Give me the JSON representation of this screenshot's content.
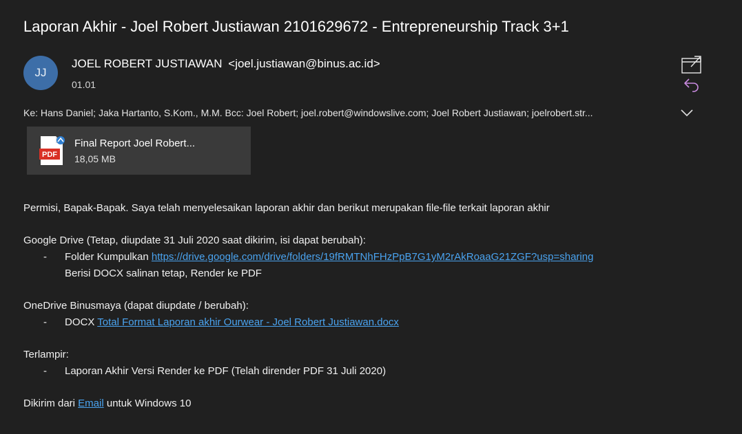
{
  "email": {
    "subject": "Laporan Akhir - Joel Robert Justiawan 2101629672 - Entrepreneurship Track 3+1",
    "avatar_initials": "JJ",
    "sender_name": "JOEL ROBERT JUSTIAWAN",
    "sender_email": "<joel.justiawan@binus.ac.id>",
    "time": "01.01",
    "recipients": "Ke: Hans Daniel; Jaka Hartanto, S.Kom., M.M. Bcc: Joel Robert; joel.robert@windowslive.com; Joel Robert Justiawan; joelrobert.str...",
    "attachment": {
      "name": "Final Report Joel Robert...",
      "size": "18,05 MB",
      "badge": "PDF"
    }
  },
  "body": {
    "intro": "Permisi, Bapak-Bapak. Saya telah menyelesaikan laporan akhir dan berikut merupakan file-file terkait laporan akhir",
    "gdrive_heading": "Google Drive (Tetap, diupdate 31 Juli 2020 saat dikirim, isi dapat berubah):",
    "gdrive_item_prefix": "Folder Kumpulkan ",
    "gdrive_link": "https://drive.google.com/drive/folders/19fRMTNhFHzPpB7G1yM2rAkRoaaG21ZGF?usp=sharing",
    "gdrive_note": "Berisi DOCX salinan tetap, Render ke PDF",
    "onedrive_heading": "OneDrive Binusmaya (dapat diupdate / berubah):",
    "onedrive_item_prefix": "DOCX ",
    "onedrive_link": "Total Format Laporan akhir Ourwear - Joel Robert Justiawan.docx",
    "attached_heading": "Terlampir:",
    "attached_item": "Laporan Akhir Versi Render ke PDF (Telah dirender PDF 31 Juli 2020)",
    "footer_prefix": "Dikirim dari ",
    "footer_link": "Email",
    "footer_suffix": " untuk Windows 10",
    "dash": "-"
  },
  "colors": {
    "background": "#202020",
    "link": "#4aa3ef",
    "avatar": "#3d6ea8",
    "reply_icon": "#c98ae0",
    "attachment_bg": "#3a3a3a"
  },
  "icons": [
    "popout-icon",
    "reply-icon",
    "chevron-down-icon",
    "pdf-file-icon"
  ]
}
